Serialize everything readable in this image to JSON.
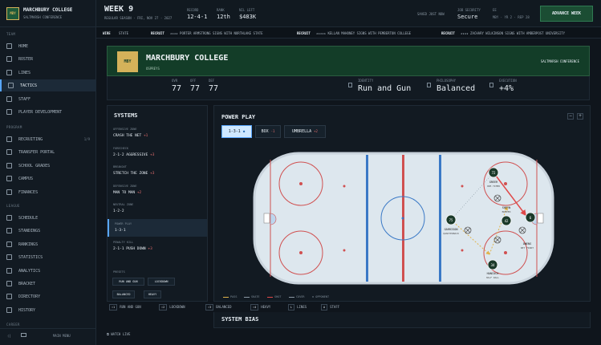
{
  "brand": {
    "crest": "MBY",
    "name": "MARCHBURY COLLEGE",
    "conference": "SALTMARSH CONFERENCE"
  },
  "nav": {
    "team_label": "TEAM",
    "team_items": [
      {
        "label": "HOME",
        "icon": "home-icon"
      },
      {
        "label": "ROSTER",
        "icon": "roster-icon"
      },
      {
        "label": "LINES",
        "icon": "lines-icon"
      },
      {
        "label": "TACTICS",
        "icon": "tactics-icon",
        "active": true
      },
      {
        "label": "STAFF",
        "icon": "staff-icon"
      },
      {
        "label": "PLAYER DEVELOPMENT",
        "icon": "development-icon"
      }
    ],
    "program_label": "PROGRAM",
    "program_items": [
      {
        "label": "RECRUITING",
        "icon": "recruiting-icon",
        "count": "1/9"
      },
      {
        "label": "TRANSFER PORTAL",
        "icon": "transfer-icon"
      },
      {
        "label": "SCHOOL GRADES",
        "icon": "grades-icon"
      },
      {
        "label": "CAMPUS",
        "icon": "campus-icon"
      },
      {
        "label": "FINANCES",
        "icon": "finances-icon"
      }
    ],
    "league_label": "LEAGUE",
    "league_items": [
      {
        "label": "SCHEDULE",
        "icon": "schedule-icon"
      },
      {
        "label": "STANDINGS",
        "icon": "standings-icon"
      },
      {
        "label": "RANKINGS",
        "icon": "rankings-icon"
      },
      {
        "label": "STATISTICS",
        "icon": "statistics-icon"
      },
      {
        "label": "ANALYTICS",
        "icon": "analytics-icon"
      },
      {
        "label": "BRACKET",
        "icon": "bracket-icon"
      },
      {
        "label": "DIRECTORY",
        "icon": "directory-icon"
      },
      {
        "label": "HISTORY",
        "icon": "history-icon"
      }
    ],
    "career_label": "CAREER",
    "main_menu": "MAIN MENU"
  },
  "header": {
    "week": "WEEK 9",
    "subtitle": "REGULAR SEASON · FRI, NOV 27 · 2027",
    "stats": [
      {
        "key": "RECORD",
        "value": "12-4-1"
      },
      {
        "key": "RANK",
        "value": "12th"
      },
      {
        "key": "NIL LEFT",
        "value": "$483K"
      }
    ],
    "saved": "SAVED JUST NOW",
    "job_security": {
      "key": "JOB SECURITY",
      "value": "Secure"
    },
    "ee": {
      "key": "EE",
      "value": "MBY · YR 2 · REP 28"
    },
    "advance": "ADVANCE WEEK"
  },
  "ticker": [
    {
      "tag": "WIRE",
      "text": "STATE"
    },
    {
      "tag": "RECRUIT",
      "text": "★★★★ PORTER ARMSTRONG SIGNS WITH NORTHLAKE STATE"
    },
    {
      "tag": "RECRUIT",
      "text": "★★★★★ KELLAN MAHONEY SIGNS WITH PEMBERTON COLLEGE"
    },
    {
      "tag": "RECRUIT",
      "text": "★★★★ ZACHARY WILKINSON SIGNS WITH AMBERPOST UNIVERSITY"
    }
  ],
  "team": {
    "crest": "MBY",
    "name": "MARCHBURY COLLEGE",
    "nickname": "OSPREYS",
    "conference": "SALTMARSH CONFERENCE"
  },
  "ratings": [
    {
      "key": "OVR",
      "value": "77"
    },
    {
      "key": "OFF",
      "value": "77"
    },
    {
      "key": "DEF",
      "value": "77"
    }
  ],
  "identity": {
    "key": "IDENTITY",
    "value": "Run and Gun"
  },
  "philosophy": {
    "key": "PHILOSOPHY",
    "value": "Balanced"
  },
  "execution": {
    "key": "EXECUTION",
    "value": "+4%"
  },
  "systems": {
    "title": "SYSTEMS",
    "rows": [
      {
        "key": "OFFENSIVE ZONE",
        "value": "CRASH THE NET",
        "delta": "+1"
      },
      {
        "key": "FORECHECK",
        "value": "2-1-2 AGGRESSIVE",
        "delta": "+3"
      },
      {
        "key": "BREAKOUT",
        "value": "STRETCH THE ZONE",
        "delta": "+3"
      },
      {
        "key": "DEFENSIVE ZONE",
        "value": "MAN TO MAN",
        "delta": "+2"
      },
      {
        "key": "NEUTRAL ZONE",
        "value": "1-2-2",
        "delta": ""
      },
      {
        "key": "POWER PLAY",
        "value": "1-3-1",
        "delta": "",
        "active": true
      },
      {
        "key": "PENALTY KILL",
        "value": "2-1-1 PUSH DOWN",
        "delta": "+3"
      }
    ],
    "presets_label": "PRESETS",
    "presets": [
      "RUN AND GUN",
      "LOCKDOWN",
      "BALANCED",
      "HEAVY"
    ]
  },
  "powerplay": {
    "title": "POWER PLAY",
    "tabs": [
      {
        "label": "1-3-1",
        "delta": "",
        "selected": true
      },
      {
        "label": "BOX",
        "delta": "-1"
      },
      {
        "label": "UMBRELLA",
        "delta": "+2"
      }
    ],
    "controls": [
      "−",
      "+"
    ],
    "players": [
      {
        "number": "72",
        "name": "GREER",
        "role": "ONE-TIMER"
      },
      {
        "number": "42",
        "name": "SHEYN",
        "role": "BUMPER"
      },
      {
        "number": "6",
        "name": "",
        "role": ""
      },
      {
        "number": "75",
        "name": "GARRISON",
        "role": "QUARTERBACK"
      },
      {
        "number": "",
        "name": "OWENS",
        "role": "NET FRONT"
      },
      {
        "number": "34",
        "name": "HANCOCK",
        "role": "HALF WALL"
      }
    ],
    "legend": [
      "PASS",
      "SKATE",
      "SHOT",
      "COVER",
      "OPPONENT"
    ],
    "colors": {
      "pass": "#e0b34a",
      "skate": "#8a97a3",
      "shot": "#e04848",
      "cover": "#8a97a3"
    }
  },
  "keybar": [
    {
      "key": "⇧1",
      "label": "RUN AND GUN"
    },
    {
      "key": "⇧2",
      "label": "LOCKDOWN"
    },
    {
      "key": "⇧3",
      "label": "BALANCED"
    },
    {
      "key": "⇧4",
      "label": "HEAVY"
    },
    {
      "key": "L",
      "label": "LINES"
    },
    {
      "key": "A",
      "label": "STAFF"
    }
  ],
  "system_bias": "SYSTEM BIAS",
  "watch_live": "WATCH LIVE"
}
